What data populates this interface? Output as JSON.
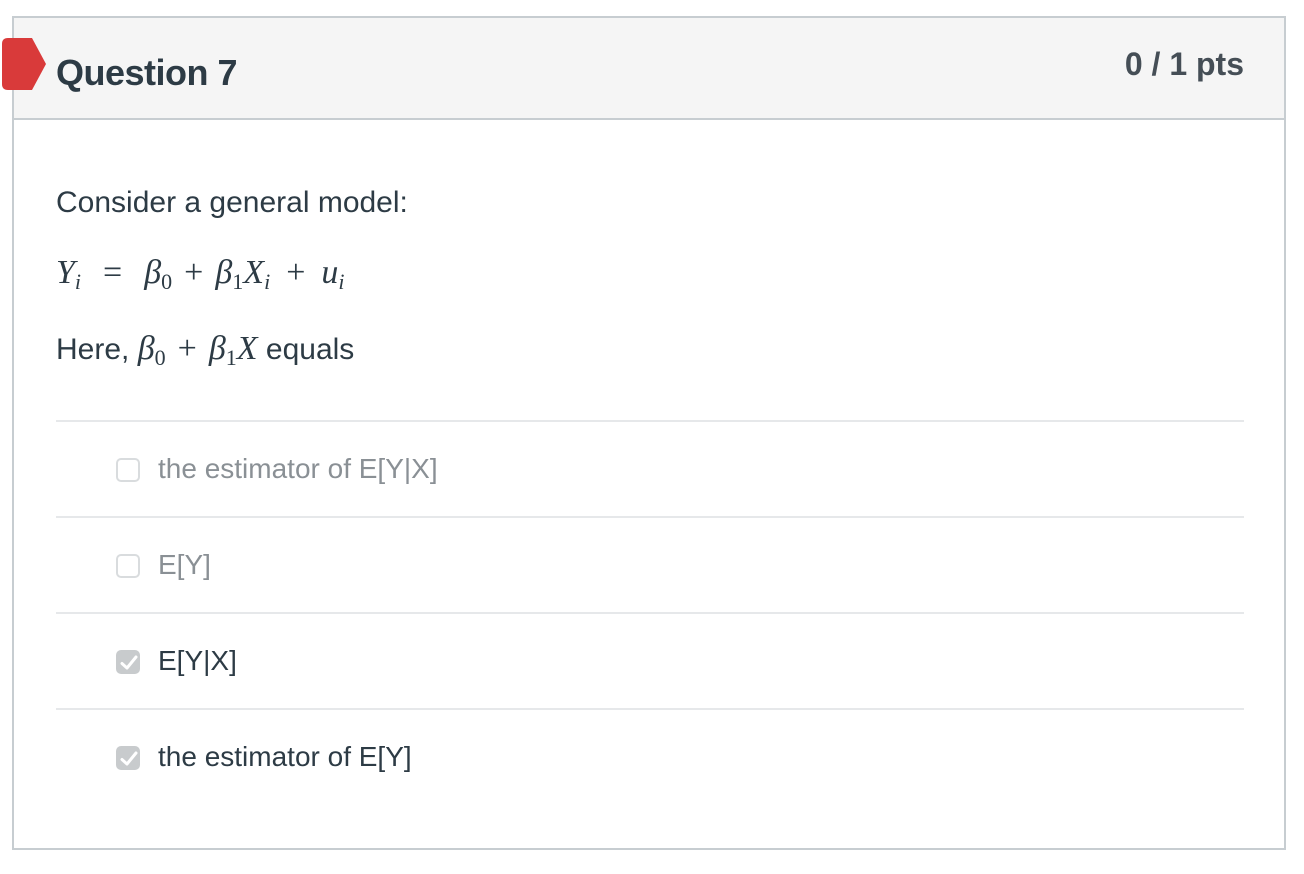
{
  "question": {
    "title": "Question 7",
    "points": "0 / 1 pts",
    "status_color": "#d93a3a",
    "intro": "Consider a general model:",
    "equation": {
      "lhs_var": "Y",
      "lhs_sub": "i",
      "equals": "=",
      "b0": "β",
      "b0_sub": "0",
      "plus1": "+",
      "b1": "β",
      "b1_sub": "1",
      "x_var": "X",
      "x_sub": "i",
      "plus2": "+",
      "u_var": "u",
      "u_sub": "i"
    },
    "here": {
      "prefix": "Here,",
      "b0": "β",
      "b0_sub": "0",
      "plus": "+",
      "b1": "β",
      "b1_sub": "1",
      "x_var": "X",
      "suffix": "equals"
    },
    "answers": [
      {
        "label": "the estimator of E[Y|X]",
        "checked": false
      },
      {
        "label": "E[Y]",
        "checked": false
      },
      {
        "label": "E[Y|X]",
        "checked": true
      },
      {
        "label": "the estimator of E[Y]",
        "checked": true
      }
    ]
  }
}
